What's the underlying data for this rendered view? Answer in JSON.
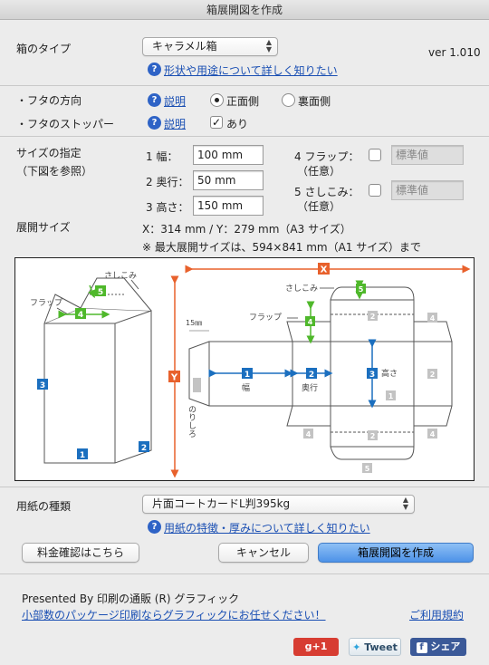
{
  "window": {
    "title": "箱展開図を作成"
  },
  "version": "ver 1.010",
  "box_type": {
    "label": "箱のタイプ",
    "selected": "キャラメル箱",
    "help_link": "形状や用途について詳しく知りたい"
  },
  "lid_direction": {
    "label": "・フタの方向",
    "help": "説明",
    "options": [
      "正面側",
      "裏面側"
    ],
    "selected_index": 0
  },
  "lid_stopper": {
    "label": "・フタのストッパー",
    "help": "説明",
    "checkbox_label": "あり",
    "checked": true
  },
  "size": {
    "label": "サイズの指定",
    "sublabel": "（下図を参照）",
    "width": {
      "label": "1 幅：",
      "value": "100 mm"
    },
    "depth": {
      "label": "2 奥行：",
      "value": "50 mm"
    },
    "height": {
      "label": "3 高さ：",
      "value": "150 mm"
    },
    "flap": {
      "label": "4 フラップ：",
      "sub": "（任意）",
      "placeholder": "標準値"
    },
    "tuck": {
      "label": "5 さしこみ：",
      "sub": "（任意）",
      "placeholder": "標準値"
    }
  },
  "unfold": {
    "label": "展開サイズ",
    "value": "X：314 mm / Y：279 mm（A3 サイズ）",
    "note": "※ 最大展開サイズは、594×841 mm（A1 サイズ）まで"
  },
  "diagram": {
    "x_label": "X",
    "y_label": "Y",
    "sashikomi": "さしこみ",
    "flap": "フラップ",
    "margin_15": "15㎜",
    "norishiro": "のりしろ",
    "width": "幅",
    "depth": "奥行",
    "height": "高さ",
    "n1": "1",
    "n2": "2",
    "n3": "3",
    "n4": "4",
    "n5": "5"
  },
  "paper": {
    "label": "用紙の種類",
    "selected": "片面コートカードL判395kg",
    "help_link": "用紙の特徴・厚みについて詳しく知りたい"
  },
  "buttons": {
    "price": "料金確認はこちら",
    "cancel": "キャンセル",
    "create": "箱展開図を作成"
  },
  "footer": {
    "presented": "Presented By 印刷の通販 (R) グラフィック",
    "promo_link": "小部数のパッケージ印刷ならグラフィックにお任せください！",
    "terms_link": "ご利用規約"
  },
  "social": {
    "gplus": "g+1",
    "tweet": "Tweet",
    "share": "シェア"
  },
  "colors": {
    "accent_blue": "#1b6fbf",
    "accent_green": "#4fb82b",
    "accent_orange": "#e8612c",
    "gray_marker": "#c3c3c3"
  }
}
